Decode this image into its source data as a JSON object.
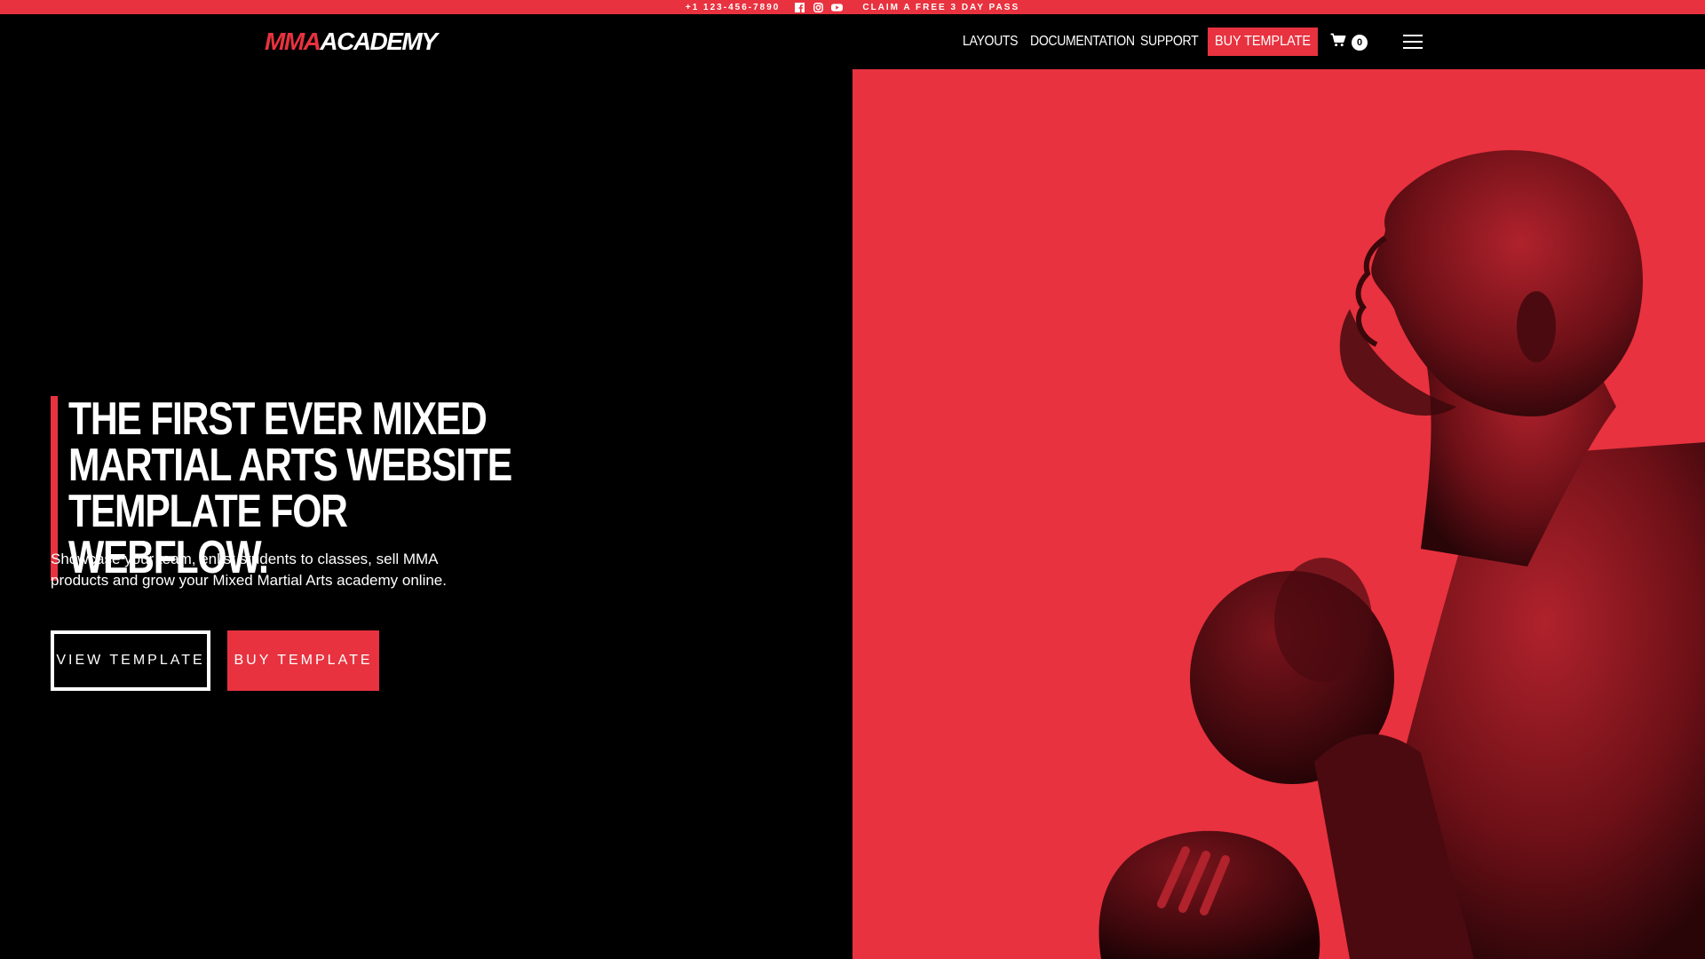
{
  "topbar": {
    "phone": "+1 123-456-7890",
    "social_icons": [
      "facebook-icon",
      "instagram-icon",
      "youtube-icon"
    ],
    "claim_text": "CLAIM A FREE 3 DAY PASS"
  },
  "navbar": {
    "logo_part1": "MMA",
    "logo_part2": "ACADEMY",
    "links": [
      "LAYOUTS",
      "DOCUMENTATION",
      "SUPPORT"
    ],
    "buy_label": "BUY TEMPLATE",
    "cart_count": "0",
    "menu_icon": "hamburger-icon"
  },
  "hero": {
    "headline": "THE FIRST EVER MIXED MARTIAL ARTS WEBSITE TEMPLATE FOR WEBFLOW.",
    "subtext": "Showcase your team, enlist students to classes, sell MMA products and grow your Mixed Martial Arts academy online.",
    "view_button": "VIEW TEMPLATE",
    "buy_button": "BUY TEMPLATE"
  },
  "colors": {
    "accent": "#e8323f",
    "background": "#000000",
    "text": "#ffffff"
  }
}
